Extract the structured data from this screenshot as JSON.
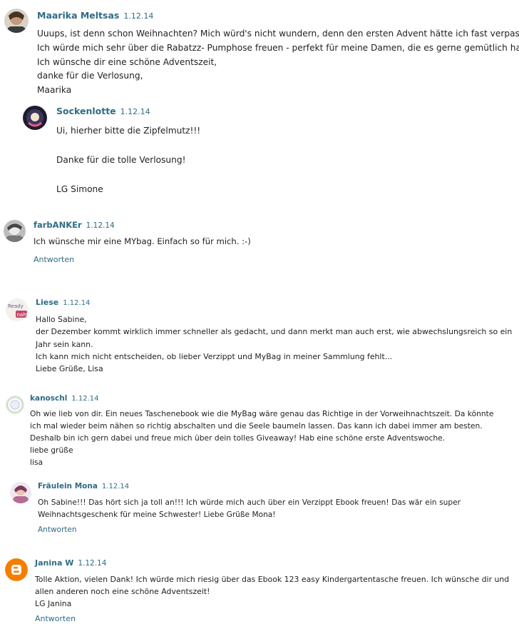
{
  "reply_label": "Antworten",
  "colors": {
    "link": "#2f6c84",
    "text": "#222222",
    "blogger_orange": "#f57d00"
  },
  "comments": [
    {
      "author": "Maarika Meltsas",
      "date": "1.12.14",
      "lines": [
        "Uuups, ist denn schon Weihnachten? Mich würd's nicht wundern, denn den ersten Advent hätte ich fast verpasst ;-)",
        "Ich würde mich sehr über die Rabatzz- Pumphose freuen - perfekt für meine Damen, die es gerne gemütlich haben.",
        "Ich wünsche dir eine schöne Adventszeit,",
        "danke für die Verlosung,",
        "Maarika"
      ]
    },
    {
      "author": "Sockenlotte",
      "date": "1.12.14",
      "lines": [
        "Ui, hierher bitte die Zipfelmutz!!!",
        "",
        "Danke für die tolle Verlosung!",
        "",
        "LG Simone"
      ]
    },
    {
      "author": "farbANKEr",
      "date": "1.12.14",
      "lines": [
        "Ich wünsche mir eine MYbag. Einfach so für mich. :-)"
      ]
    },
    {
      "author": "Liese",
      "date": "1.12.14",
      "avatar_text": "Ready naht",
      "lines": [
        "Hallo Sabine,",
        "der Dezember kommt wirklich immer schneller als gedacht, und dann merkt man auch erst, wie abwechslungsreich so ein",
        "Jahr sein kann.",
        "Ich kann mich nicht entscheiden, ob lieber Verzippt und MyBag in meiner Sammlung fehlt...",
        "Liebe Grüße, Lisa"
      ]
    },
    {
      "author": "kanoschl",
      "date": "1.12.14",
      "lines": [
        "Oh wie lieb von dir. Ein neues Taschenebook wie die MyBag wäre genau das Richtige in der Vorweihnachtszeit. Da könnte",
        "ich mal wieder beim nähen so richtig abschalten und die Seele baumeln lassen. Das kann ich dabei immer am besten.",
        "Deshalb bin ich gern dabei und freue mich über dein tolles Giveaway! Hab eine schöne erste Adventswoche.",
        "liebe grüße",
        "lisa"
      ]
    },
    {
      "author": "Fräulein Mona",
      "date": "1.12.14",
      "lines": [
        "Oh Sabine!!! Das hört sich ja toll an!!! Ich würde mich auch über ein Verzippt Ebook freuen! Das wär ein super",
        "Weihnachtsgeschenk für meine Schwester! Liebe Grüße Mona!"
      ]
    },
    {
      "author": "Janina W",
      "date": "1.12.14",
      "lines": [
        "Tolle Aktion, vielen Dank! Ich würde mich riesig über das Ebook 123 easy Kindergartentasche freuen. Ich wünsche dir und",
        "allen anderen noch eine schöne Adventszeit!",
        "LG Janina"
      ]
    }
  ]
}
